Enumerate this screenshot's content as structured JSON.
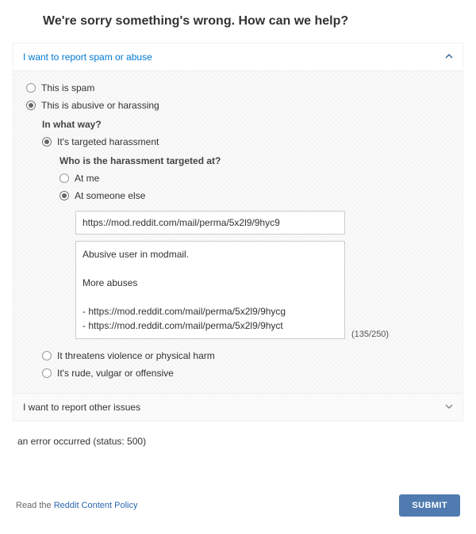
{
  "heading": "We're sorry something's wrong. How can we help?",
  "accordion": {
    "spam_abuse_label": "I want to report spam or abuse",
    "other_issues_label": "I want to report other issues"
  },
  "options": {
    "spam": "This is spam",
    "abusive": "This is abusive or harassing",
    "way_q": "In what way?",
    "targeted": "It's targeted harassment",
    "target_q": "Who is the harassment targeted at?",
    "at_me": "At me",
    "at_someone": "At someone else",
    "violence": "It threatens violence or physical harm",
    "rude": "It's rude, vulgar or offensive"
  },
  "inputs": {
    "url_value": "https://mod.reddit.com/mail/perma/5x2l9/9hyc9",
    "comment_value": "Abusive user in modmail.\n\nMore abuses\n\n- https://mod.reddit.com/mail/perma/5x2l9/9hycg\n- https://mod.reddit.com/mail/perma/5x2l9/9hyct",
    "counter": "(135/250)"
  },
  "error": "an error occurred (status: 500)",
  "footer": {
    "read_the": "Read the ",
    "policy_link": "Reddit Content Policy",
    "submit": "SUBMIT"
  }
}
